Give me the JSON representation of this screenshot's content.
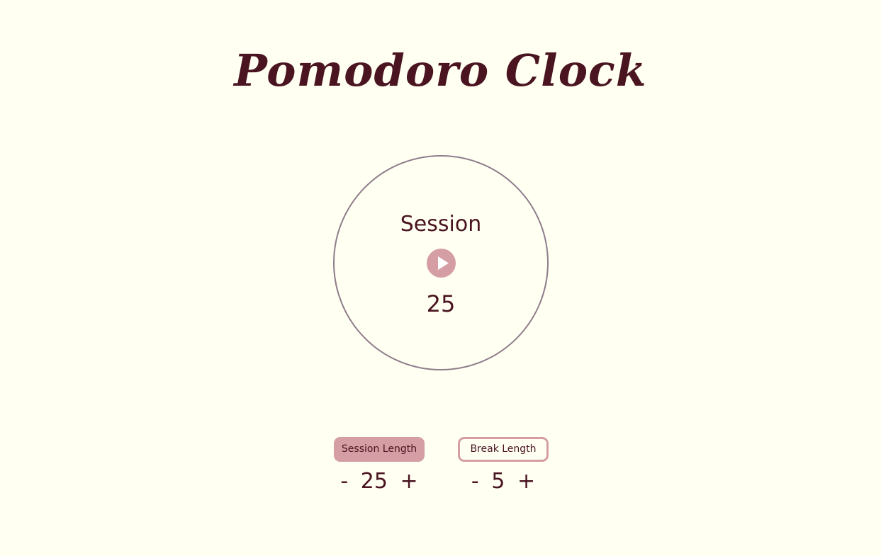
{
  "header": {
    "title": "Pomodoro Clock"
  },
  "clock": {
    "mode": "Session",
    "time": "25",
    "play_icon": "play-icon"
  },
  "settings": {
    "session": {
      "label": "Session Length",
      "decrement": "-",
      "value": "25",
      "increment": "+"
    },
    "break": {
      "label": "Break Length",
      "decrement": "-",
      "value": "5",
      "increment": "+"
    }
  },
  "colors": {
    "background": "#fffff2",
    "text": "#4a1420",
    "accent": "#d59ea5",
    "ring": "#8f7d8c"
  }
}
